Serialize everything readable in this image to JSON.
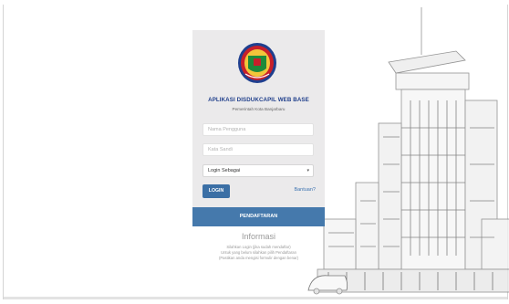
{
  "app": {
    "title": "APLIKASI DISDUKCAPIL WEB BASE",
    "subtitle": "Pemerintah Kota Banjarbaru"
  },
  "form": {
    "username_placeholder": "Nama Pengguna",
    "password_placeholder": "Kata Sandi",
    "role_select_value": "Login Sebagai",
    "login_label": "LOGIN",
    "help_label": "Bantuan?",
    "register_label": "PENDAFTARAN"
  },
  "info": {
    "title": "Informasi",
    "lines": [
      "Silahkan Login (jika sudah mendaftar)",
      "Untuk yang belum silahkan pilih Pendaftaran",
      "(Pastikan anda mengisi formulir dengan benar)"
    ]
  },
  "colors": {
    "primary": "#4579ac",
    "title_blue": "#21408c",
    "panel_bg": "#ebeaeb"
  },
  "icons": {
    "logo": "city-emblem",
    "select_arrow": "chevron-down-icon"
  }
}
